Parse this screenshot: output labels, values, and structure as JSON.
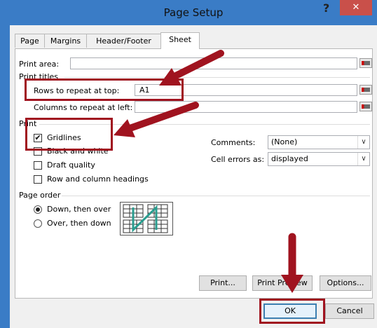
{
  "window": {
    "title": "Page Setup",
    "help": "?",
    "close": "✕"
  },
  "tabs": [
    {
      "label": "Page"
    },
    {
      "label": "Margins"
    },
    {
      "label": "Header/Footer"
    },
    {
      "label": "Sheet"
    }
  ],
  "sheet": {
    "print_area_label": "Print area:",
    "print_area_value": "",
    "print_titles_label": "Print titles",
    "rows_label": "Rows to repeat at top:",
    "rows_value": "A1",
    "cols_label": "Columns to repeat at left:",
    "cols_value": "",
    "print_section_label": "Print",
    "gridlines_label": "Gridlines",
    "gridlines_checked": "✔",
    "bw_label": "Black and white",
    "draft_label": "Draft quality",
    "rowcol_label": "Row and column headings",
    "comments_label": "Comments:",
    "comments_value": "(None)",
    "cell_errors_label": "Cell errors as:",
    "cell_errors_value": "displayed",
    "page_order_label": "Page order",
    "down_over_label": "Down, then over",
    "over_down_label": "Over, then down"
  },
  "buttons": {
    "print": "Print...",
    "print_preview": "Print Preview",
    "options": "Options...",
    "ok": "OK",
    "cancel": "Cancel"
  },
  "colors": {
    "accent": "#3a7cc6",
    "highlight": "#a0131f",
    "close": "#c9504a"
  }
}
